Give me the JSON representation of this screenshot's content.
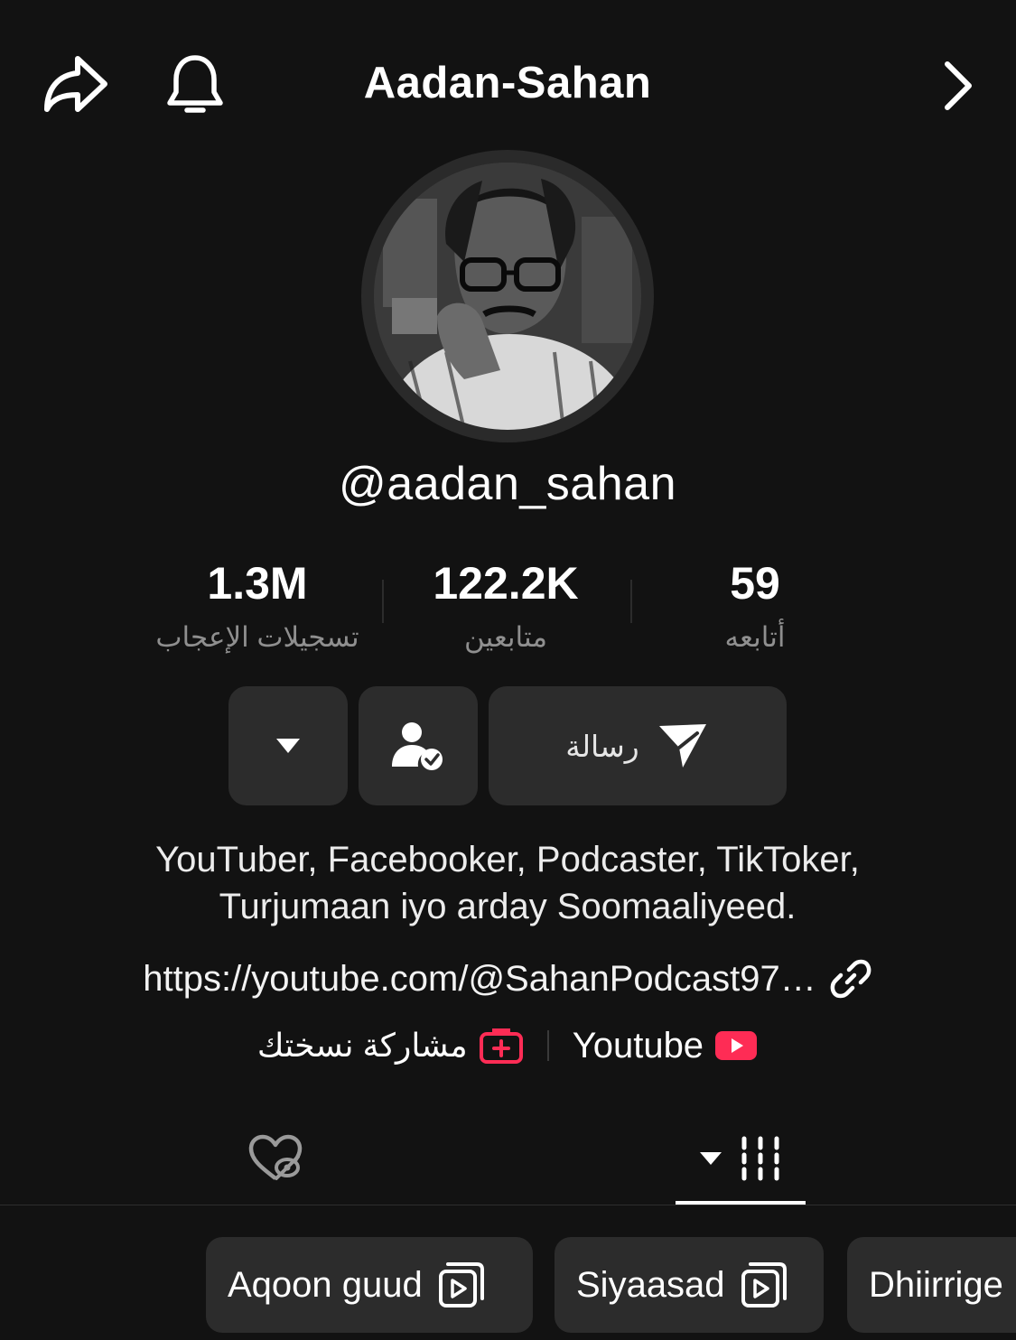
{
  "header": {
    "title": "Aadan-Sahan",
    "icons": [
      "share-icon",
      "bell-icon",
      "chevron-right-icon"
    ]
  },
  "profile": {
    "handle": "@aadan_sahan"
  },
  "stats": {
    "likes": {
      "value": "1.3M",
      "label": "تسجيلات الإعجاب"
    },
    "followers": {
      "value": "122.2K",
      "label": "متابعين"
    },
    "following": {
      "value": "59",
      "label": "أتابعه"
    }
  },
  "actions": {
    "message_label": "رسالة",
    "icons": [
      "caret-down-icon",
      "friends-check-icon",
      "send-icon"
    ]
  },
  "bio": {
    "line1": "YouTuber, Facebooker, Podcaster, TikToker,",
    "line2": "Turjumaan iyo arday Soomaaliyeed."
  },
  "link": {
    "text": "https://youtube.com/@SahanPodcast97…"
  },
  "social": {
    "youtube_label": "Youtube",
    "share_copy_label": "مشاركة نسختك"
  },
  "tabs": {
    "icons": [
      "liked-hidden-icon",
      "videos-grid-icon"
    ],
    "active": "videos"
  },
  "playlists": [
    {
      "label": "Aqoon guud"
    },
    {
      "label": "Siyaasad"
    },
    {
      "label": "Dhiirrige"
    }
  ],
  "colors": {
    "background": "#121212",
    "button": "#2c2c2c",
    "accent_red": "#fe2c55",
    "muted_text": "#8f8f8f"
  }
}
